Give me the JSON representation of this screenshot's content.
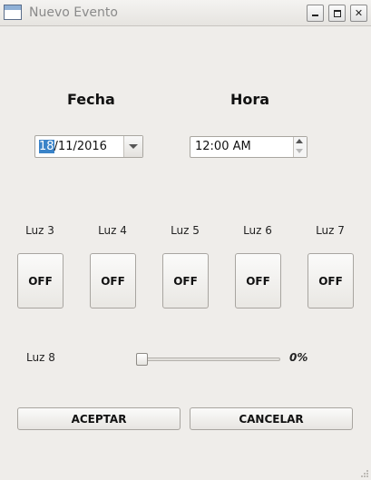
{
  "window": {
    "title": "Nuevo Evento"
  },
  "labels": {
    "fecha": "Fecha",
    "hora": "Hora"
  },
  "date": {
    "day": "18",
    "rest": "/11/2016"
  },
  "time": {
    "value": "12:00 AM"
  },
  "lights": [
    {
      "label": "Luz 3",
      "state": "OFF"
    },
    {
      "label": "Luz 4",
      "state": "OFF"
    },
    {
      "label": "Luz 5",
      "state": "OFF"
    },
    {
      "label": "Luz 6",
      "state": "OFF"
    },
    {
      "label": "Luz 7",
      "state": "OFF"
    }
  ],
  "dimmer": {
    "label": "Luz 8",
    "percent_text": "0%",
    "value": 0
  },
  "buttons": {
    "accept": "ACEPTAR",
    "cancel": "CANCELAR"
  },
  "icons": {
    "app": "window-icon",
    "minimize": "minimize-icon",
    "maximize": "maximize-icon",
    "close": "close-icon"
  }
}
